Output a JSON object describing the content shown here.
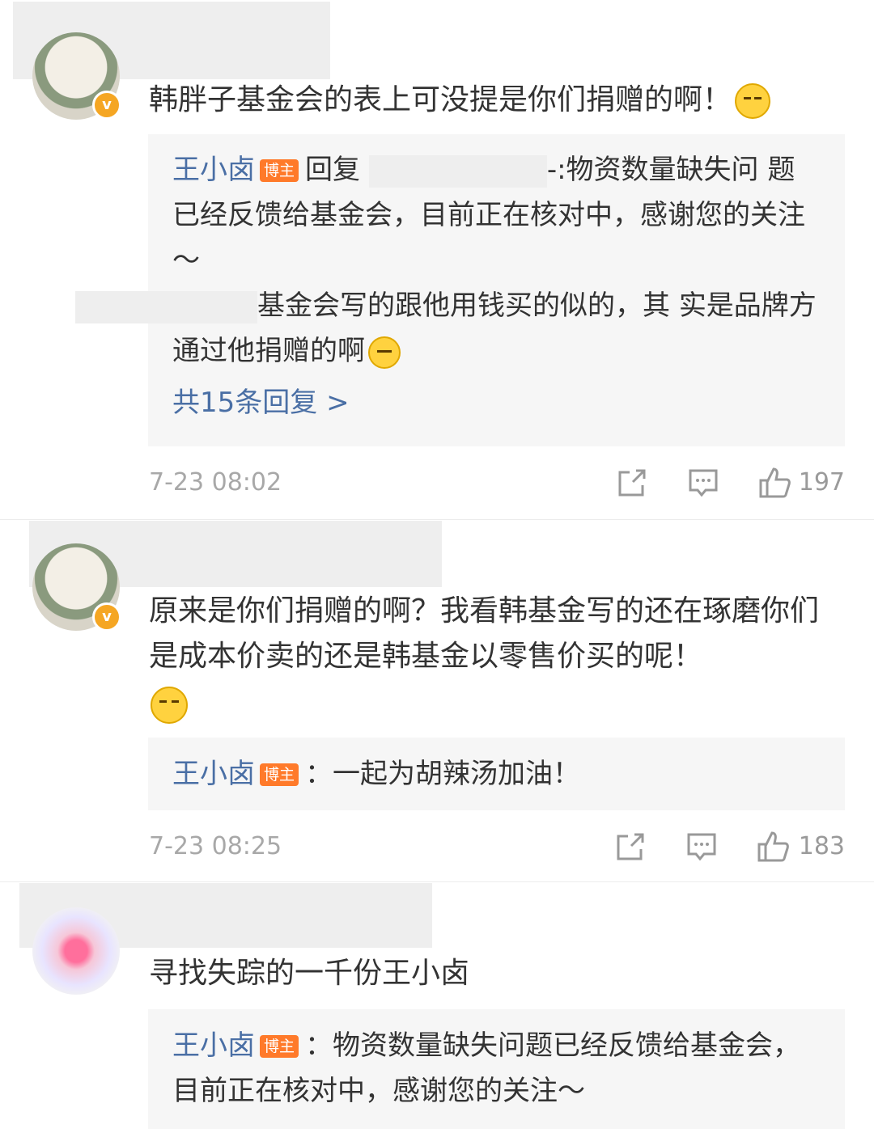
{
  "comments": [
    {
      "text": "韩胖子基金会的表上可没提是你们捐赠的啊！",
      "emoji": "shrug-emoji",
      "replies": [
        {
          "author": "王小卤",
          "badge": "博主",
          "reply_word": "回复",
          "text_after_blur": "-:物资数量缺失问",
          "text_rest": "题已经反馈给基金会，目前正在核对中，感谢您的关注～"
        },
        {
          "text_after_blur": "基金会写的跟他用钱买的似的，其",
          "text_rest": "实是品牌方通过他捐赠的啊",
          "emoji": "smirk-emoji"
        }
      ],
      "more_replies": "共15条回复 >",
      "time": "7-23 08:02",
      "likes": "197"
    },
    {
      "text": "原来是你们捐赠的啊？我看韩基金写的还在琢磨你们是成本价卖的还是韩基金以零售价买的呢！",
      "emoji": "smirk-emoji",
      "replies": [
        {
          "author": "王小卤",
          "badge": "博主",
          "text": "：一起为胡辣汤加油！"
        }
      ],
      "time": "7-23 08:25",
      "likes": "183"
    },
    {
      "text": "寻找失踪的一千份王小卤",
      "replies": [
        {
          "author": "王小卤",
          "badge": "博主",
          "text": "：物资数量缺失问题已经反馈给基金会，目前正在核对中，感谢您的关注～"
        }
      ]
    }
  ],
  "icons": {
    "share": "share-icon",
    "comment": "comment-icon",
    "like": "thumbs-up-icon",
    "verified": "verified-badge-icon"
  },
  "colors": {
    "link": "#4a6fa5",
    "host_badge": "#ff7a2a",
    "verified": "#f5a623",
    "reply_bg": "#f6f6f6"
  }
}
